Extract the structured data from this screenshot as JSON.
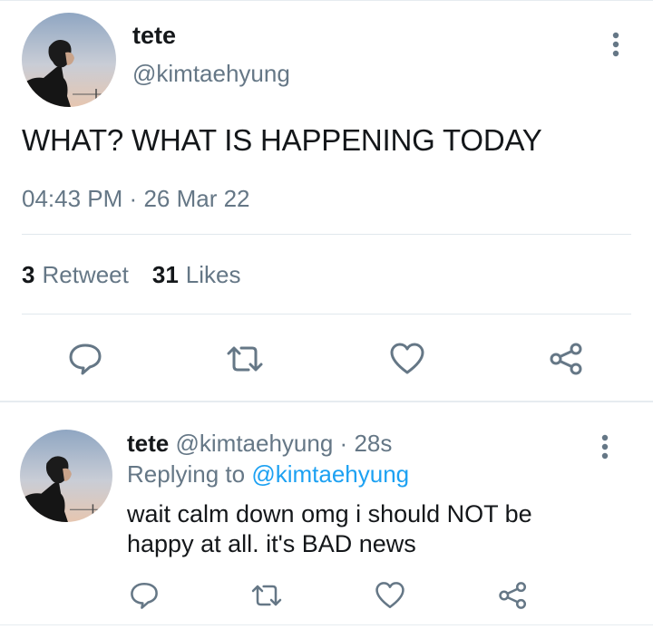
{
  "main_tweet": {
    "display_name": "tete",
    "handle": "@kimtaehyung",
    "text": "WHAT? WHAT IS HAPPENING TODAY",
    "time": "04:43 PM",
    "separator": "·",
    "date": "26 Mar 22",
    "retweet_count": "3",
    "retweet_label": "Retweet",
    "like_count": "31",
    "like_label": "Likes"
  },
  "reply_tweet": {
    "display_name": "tete",
    "handle": "@kimtaehyung",
    "separator": "·",
    "age": "28s",
    "replying_to_label": "Replying to",
    "replying_to_handle": "@kimtaehyung",
    "text_line1": "wait calm down omg i should NOT be",
    "text_line2": "happy at all. it's BAD news"
  },
  "icons": {
    "reply": "reply-icon",
    "retweet": "retweet-icon",
    "like": "heart-icon",
    "share": "share-icon",
    "more": "more-vertical-icon"
  },
  "colors": {
    "text_primary": "#14171a",
    "text_secondary": "#657786",
    "link": "#1da1f2",
    "divider": "#e1e8ed"
  }
}
